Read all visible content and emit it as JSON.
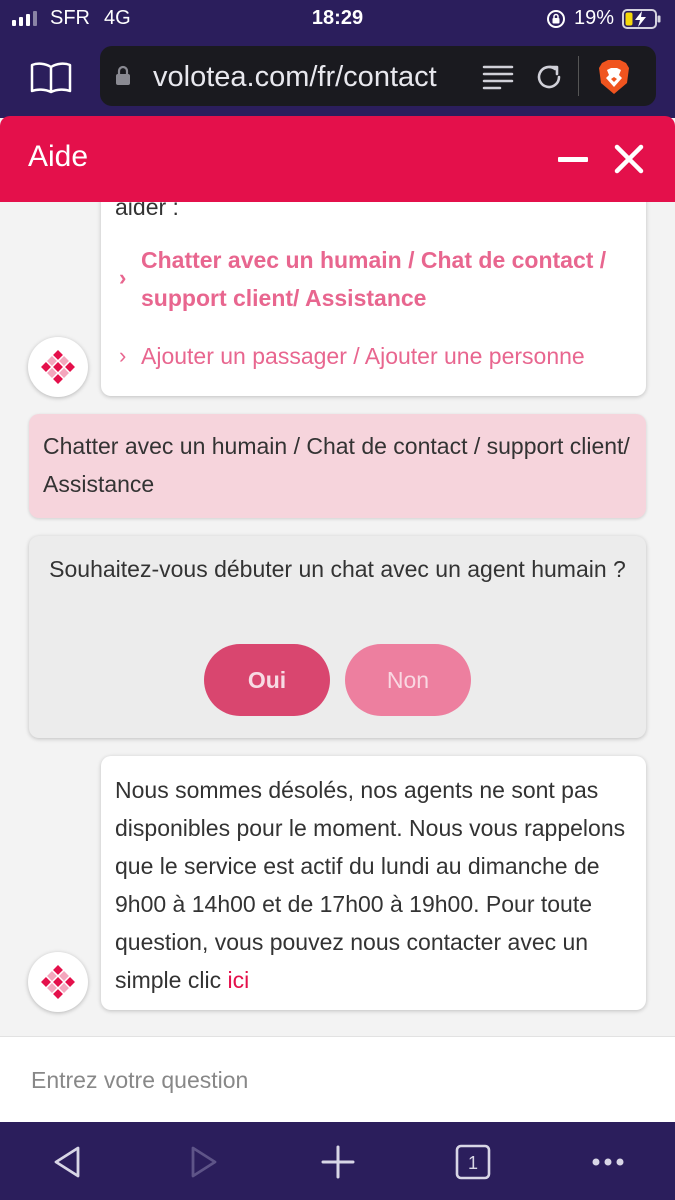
{
  "status_bar": {
    "carrier": "SFR",
    "network": "4G",
    "time": "18:29",
    "battery_percent": "19%"
  },
  "browser": {
    "url": "volotea.com/fr/contact",
    "tab_count": "1"
  },
  "help_widget": {
    "title": "Aide"
  },
  "chat": {
    "bot_message_1": {
      "intro_fragment": "aider :",
      "options": [
        "Chatter avec un humain / Chat de contact / support client/ Assistance",
        "Ajouter un passager / Ajouter une personne"
      ]
    },
    "user_message": "Chatter avec un humain / Chat de contact / support client/ Assistance",
    "confirmation": {
      "question": "Souhaitez-vous débuter un chat avec un agent humain ?",
      "yes_label": "Oui",
      "no_label": "Non"
    },
    "bot_message_2": {
      "text": "Nous sommes désolés, nos agents ne sont pas disponibles pour le moment. Nous vous rappelons que le service est actif du lundi au dimanche de 9h00 à 14h00 et de 17h00 à 19h00. Pour toute question, vous pouvez nous contacter avec un simple clic ",
      "link_text": "ici"
    }
  },
  "input": {
    "placeholder": "Entrez votre question",
    "value": ""
  },
  "colors": {
    "brand": "#e4104b",
    "browser_chrome": "#2b1e5c",
    "option_link": "#e8668f",
    "user_bubble": "#f6d4dc"
  },
  "icons": [
    "signal-icon",
    "lock-rotation-icon",
    "battery-charging-icon",
    "book-icon",
    "padlock-icon",
    "reader-icon",
    "reload-icon",
    "brave-icon",
    "minimize-icon",
    "close-icon",
    "volotea-logo-icon",
    "back-icon",
    "forward-icon",
    "add-tab-icon",
    "tabs-icon",
    "more-icon"
  ]
}
